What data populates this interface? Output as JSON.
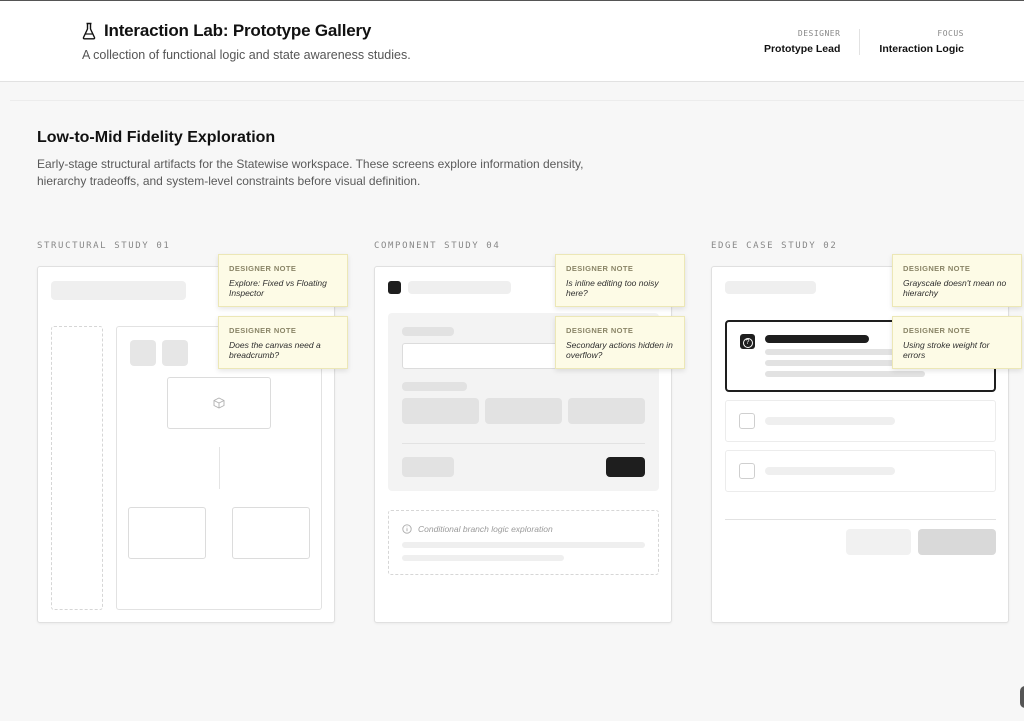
{
  "header": {
    "title": "Interaction Lab: Prototype Gallery",
    "subtitle": "A collection of functional logic and state awareness studies.",
    "icon": "flask-icon",
    "meta": [
      {
        "label": "DESIGNER",
        "value": "Prototype Lead"
      },
      {
        "label": "FOCUS",
        "value": "Interaction Logic"
      }
    ]
  },
  "section": {
    "title": "Low-to-Mid Fidelity Exploration",
    "description": "Early-stage structural artifacts for the Statewise workspace. These screens explore information density, hierarchy tradeoffs, and system-level constraints before visual definition."
  },
  "studies": [
    {
      "label": "STRUCTURAL STUDY 01",
      "notes": [
        {
          "label": "DESIGNER NOTE",
          "text": "Explore: Fixed vs Floating Inspector"
        },
        {
          "label": "DESIGNER NOTE",
          "text": "Does the canvas need a breadcrumb?"
        }
      ]
    },
    {
      "label": "COMPONENT STUDY 04",
      "conditional_text": "Conditional branch logic exploration",
      "notes": [
        {
          "label": "DESIGNER NOTE",
          "text": "Is inline editing too noisy here?"
        },
        {
          "label": "DESIGNER NOTE",
          "text": "Secondary actions hidden in overflow?"
        }
      ]
    },
    {
      "label": "EDGE CASE STUDY 02",
      "notes": [
        {
          "label": "DESIGNER NOTE",
          "text": "Grayscale doesn't mean no hierarchy"
        },
        {
          "label": "DESIGNER NOTE",
          "text": "Using stroke weight for errors"
        }
      ]
    }
  ],
  "colors": {
    "background": "#f7f7f7",
    "note_bg": "#fdfbe6",
    "placeholder": "#efefef",
    "dark": "#1e1e1e"
  }
}
